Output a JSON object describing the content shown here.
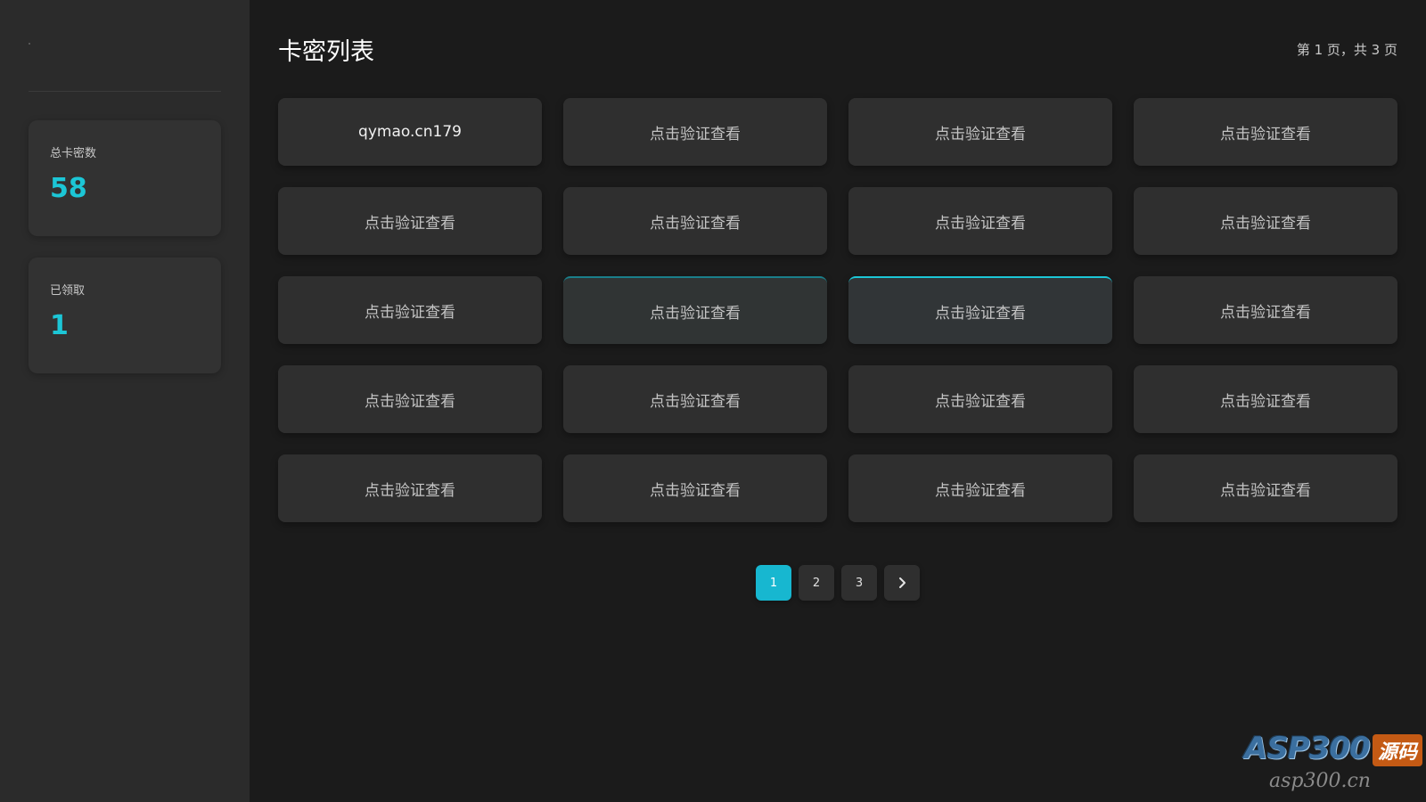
{
  "sidebar": {
    "stats": [
      {
        "label": "总卡密数",
        "value": "58"
      },
      {
        "label": "已领取",
        "value": "1"
      }
    ]
  },
  "header": {
    "title": "卡密列表",
    "page_info": "第 1 页，共 3 页"
  },
  "cards": [
    "qymao.cn179",
    "点击验证查看",
    "点击验证查看",
    "点击验证查看",
    "点击验证查看",
    "点击验证查看",
    "点击验证查看",
    "点击验证查看",
    "点击验证查看",
    "点击验证查看",
    "点击验证查看",
    "点击验证查看",
    "点击验证查看",
    "点击验证查看",
    "点击验证查看",
    "点击验证查看",
    "点击验证查看",
    "点击验证查看",
    "点击验证查看",
    "点击验证查看"
  ],
  "pagination": {
    "pages": [
      "1",
      "2",
      "3"
    ],
    "current": "1",
    "next_icon": "chevron-right-icon"
  },
  "watermark": {
    "main": "ASP300",
    "badge": "源码",
    "sub": "asp300.cn"
  },
  "colors": {
    "accent": "#17b7d0",
    "stat_value": "#1cc6d6",
    "sidebar_bg": "#2b2b2b",
    "main_bg": "#1b1b1b",
    "card_bg": "#2f2f2f"
  }
}
